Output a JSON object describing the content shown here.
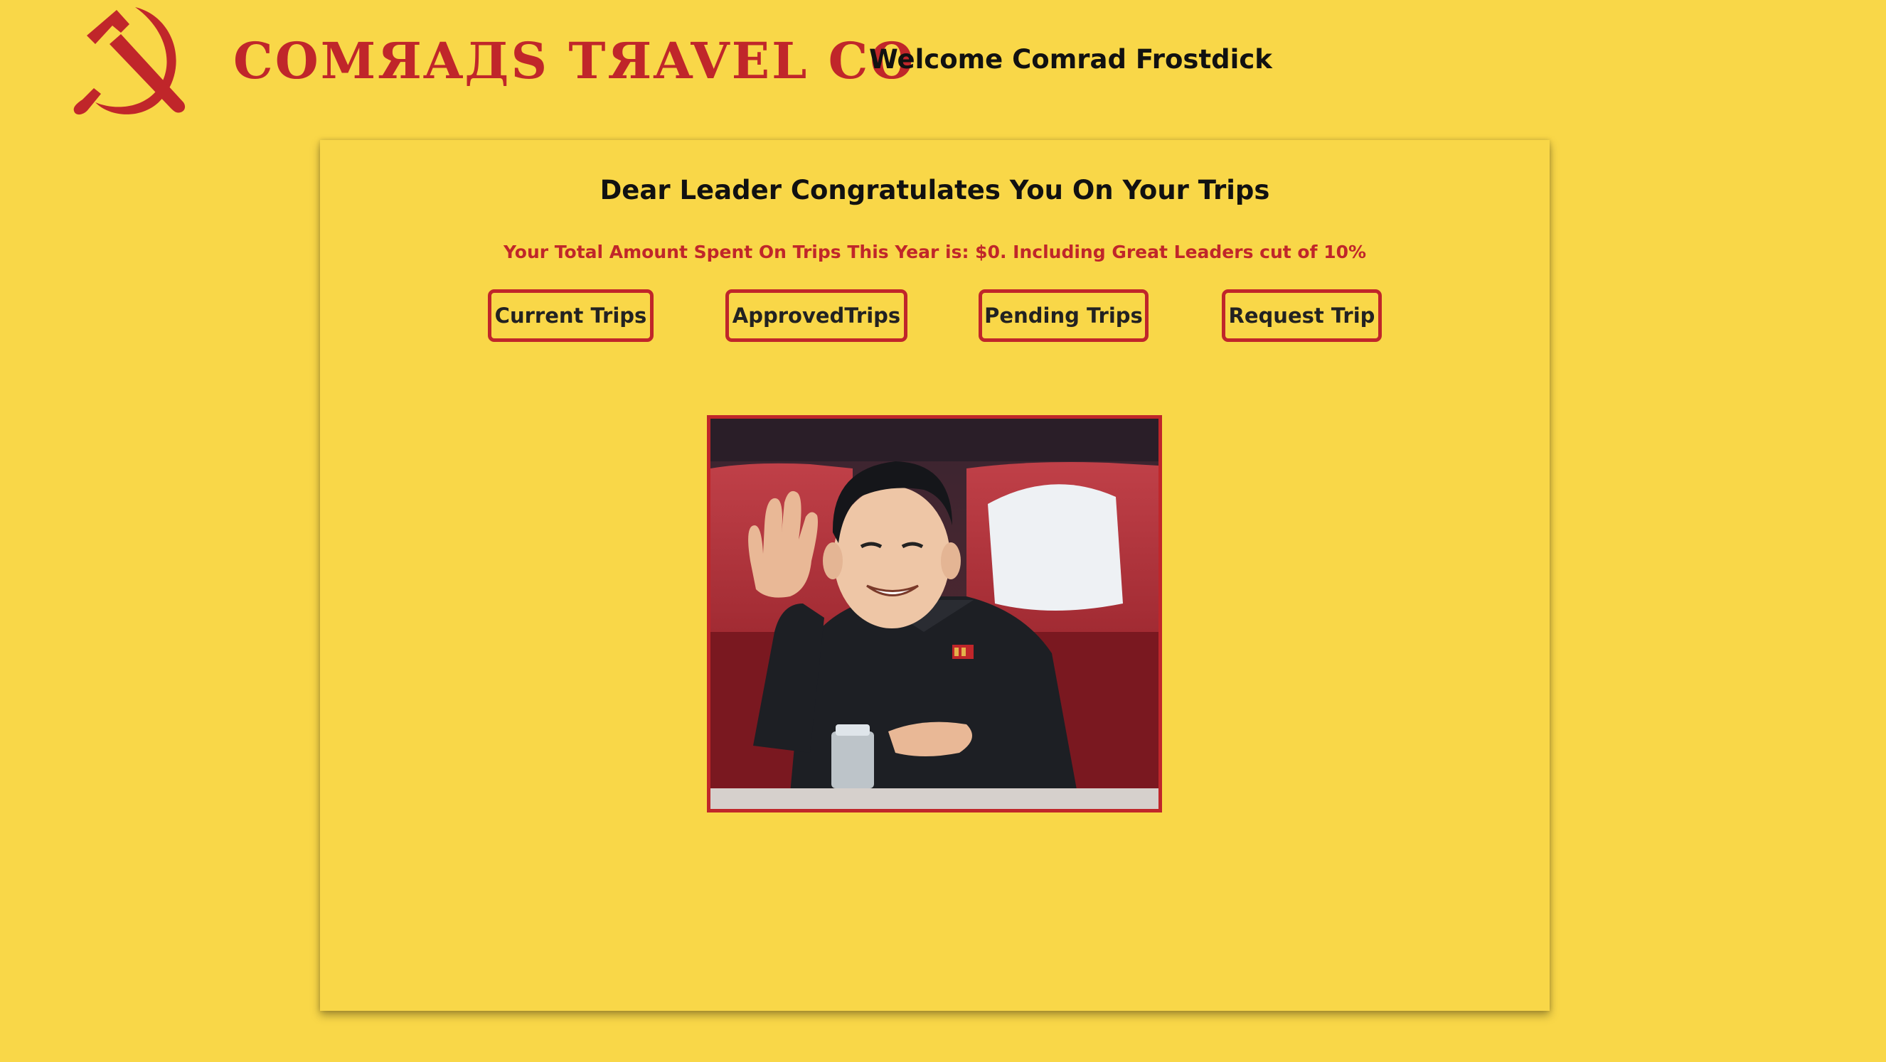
{
  "header": {
    "logo_icon": "hammer-and-sickle-icon",
    "brand": "COMЯAДS TЯAVEL CO",
    "welcome": "Welcome Comrad Frostdick"
  },
  "main": {
    "headline": "Dear Leader Congratulates You On Your Trips",
    "total_text": "Your Total Amount Spent On Trips This Year is: $0. Including Great Leaders cut of 10%",
    "buttons": {
      "current": "Current Trips",
      "approved": "ApprovedTrips",
      "pending": "Pending Trips",
      "request": "Request Trip"
    },
    "photo_subject": "leader-photo"
  },
  "colors": {
    "background": "#f9d748",
    "accent": "#c0262a",
    "text": "#111111"
  }
}
